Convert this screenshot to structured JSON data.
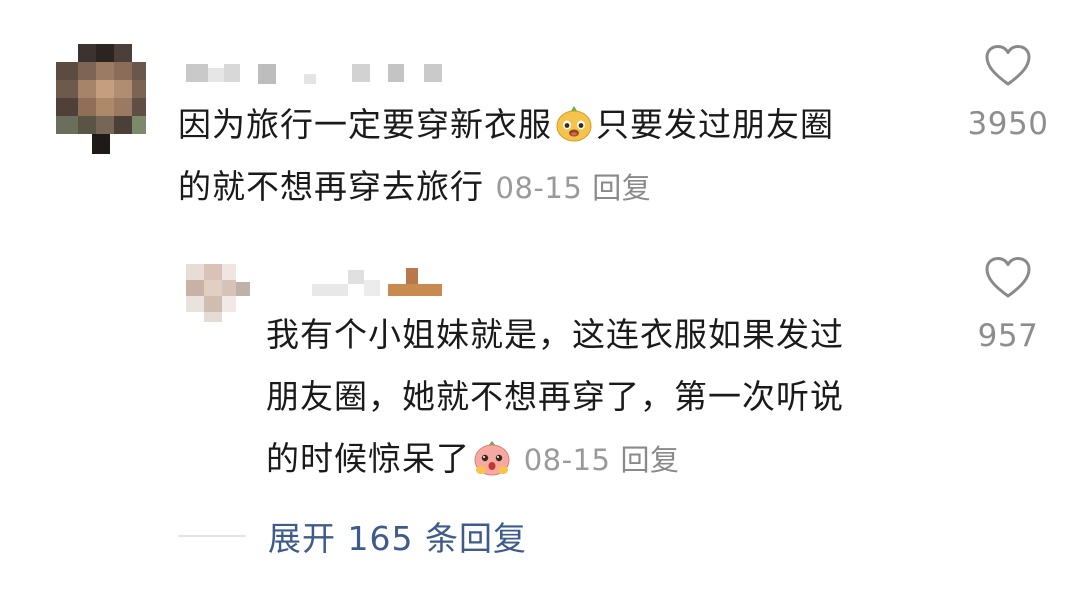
{
  "main_comment": {
    "text_line1_a": "因为旅行一定要穿新衣服",
    "text_line1_b": "只要发过朋友圈",
    "text_line2": "的就不想再穿去旅行",
    "emoji_icon": "mango-smile-emoji",
    "date": "08-15",
    "reply_label": "回复",
    "like_count": "3950"
  },
  "reply_comment": {
    "text_line1": "我有个小姐妹就是，这连衣服如果发过",
    "text_line2": "朋友圈，她就不想再穿了，第一次听说",
    "text_line3": "的时候惊呆了",
    "emoji_icon": "peach-surprised-emoji",
    "date": "08-15",
    "reply_label": "回复",
    "like_count": "957"
  },
  "expand": {
    "label": "展开 165 条回复"
  },
  "colors": {
    "text": "#1a1a1a",
    "meta": "#9a9a9a",
    "link": "#3e5b8c"
  }
}
